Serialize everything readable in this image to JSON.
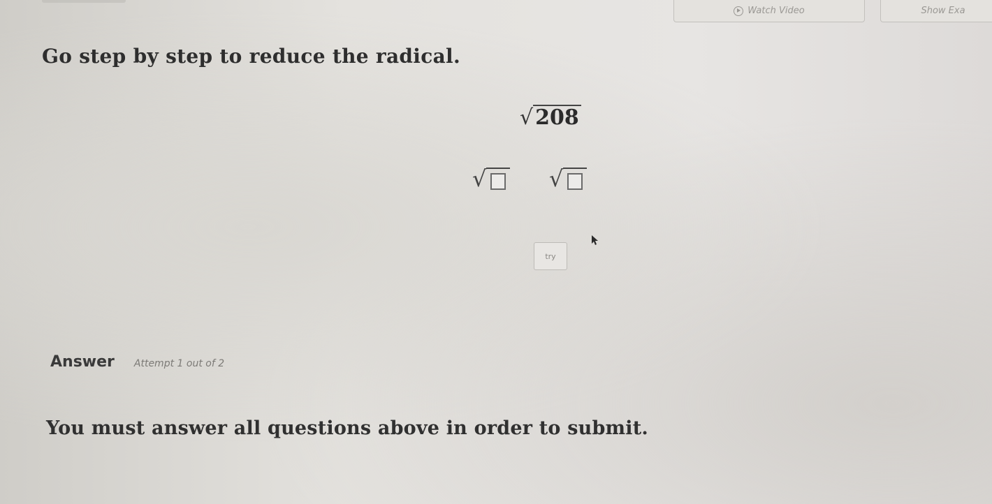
{
  "header": {
    "watch_video_label": "Watch Video",
    "show_example_label": "Show Exa"
  },
  "question": {
    "instruction": "Go step by step to reduce the radical.",
    "radicand": "208",
    "try_label": "try"
  },
  "answer": {
    "label": "Answer",
    "attempt": "Attempt 1 out of 2"
  },
  "footer": {
    "message": "You must answer all questions above in order to submit."
  },
  "icons": {
    "play": "play-circle-icon",
    "cursor": "mouse-pointer-icon"
  }
}
